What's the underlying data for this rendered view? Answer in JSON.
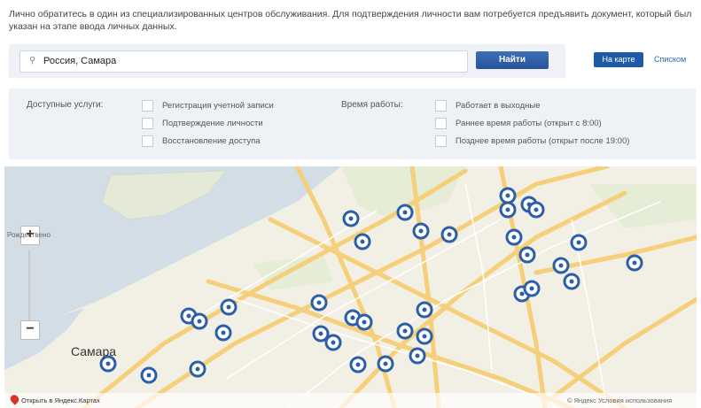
{
  "intro_text": "Лично обратитесь в один из специализированных центров обслуживания. Для подтверждения личности вам потребуется предъявить документ, который был указан на этапе ввода личных данных.",
  "search": {
    "value": "Россия, Самара",
    "button_label": "Найти",
    "icon": "search-icon"
  },
  "view_toggle": {
    "map_label": "На карте",
    "list_label": "Списком"
  },
  "filters": {
    "services_label": "Доступные услуги:",
    "services": [
      "Регистрация учетной записи",
      "Подтверждение личности",
      "Восстановление доступа"
    ],
    "hours_label": "Время работы:",
    "hours": [
      "Работает в выходные",
      "Раннее время работы (открыт с 8:00)",
      "Позднее время работы (открыт после 19:00)"
    ]
  },
  "map": {
    "city_label": "Самара",
    "place_label_1": "Рождествено",
    "zoom_in": "+",
    "zoom_out": "−",
    "footer_left": "Открыть в Яндекс.Картах",
    "footer_right": "© Яндекс Условия использования",
    "colors": {
      "water": "#d3dde6",
      "land": "#f2efe4",
      "road": "#f5cf7a",
      "marker": "#2b5fa8"
    }
  }
}
